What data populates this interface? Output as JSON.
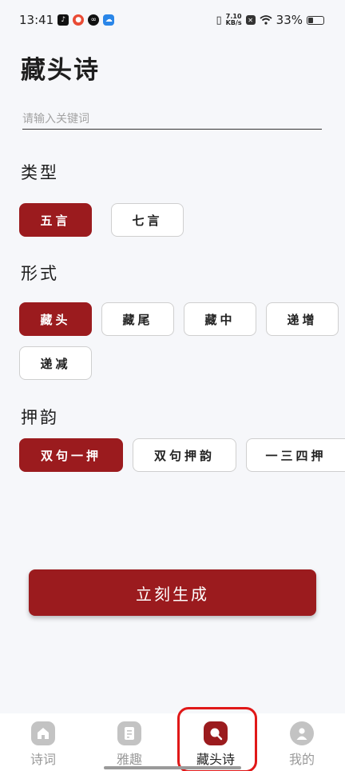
{
  "status_bar": {
    "time": "13:41",
    "net_speed_value": "7.10",
    "net_speed_unit": "KB/s",
    "battery": "33%",
    "battery_level": 0.33
  },
  "page": {
    "title": "藏头诗"
  },
  "search": {
    "placeholder": "请输入关键词",
    "value": ""
  },
  "type_section": {
    "title": "类型",
    "options": [
      {
        "label": "五言",
        "selected": true
      },
      {
        "label": "七言",
        "selected": false
      }
    ]
  },
  "form_section": {
    "title": "形式",
    "options": [
      {
        "label": "藏头",
        "selected": true
      },
      {
        "label": "藏尾",
        "selected": false
      },
      {
        "label": "藏中",
        "selected": false
      },
      {
        "label": "递增",
        "selected": false
      },
      {
        "label": "递减",
        "selected": false
      }
    ]
  },
  "rhyme_section": {
    "title": "押韵",
    "options": [
      {
        "label": "双句一押",
        "selected": true
      },
      {
        "label": "双句押韵",
        "selected": false
      },
      {
        "label": "一三四押",
        "selected": false
      }
    ]
  },
  "generate_button": {
    "label": "立刻生成"
  },
  "tab_bar": {
    "tabs": [
      {
        "label": "诗词",
        "icon": "home-icon",
        "active": false
      },
      {
        "label": "雅趣",
        "icon": "document-icon",
        "active": false
      },
      {
        "label": "藏头诗",
        "icon": "search-icon",
        "active": true
      },
      {
        "label": "我的",
        "icon": "user-icon",
        "active": false
      }
    ]
  },
  "colors": {
    "accent": "#9b1b1e",
    "highlight_ring": "#e01818",
    "background": "#f6f7fa"
  }
}
